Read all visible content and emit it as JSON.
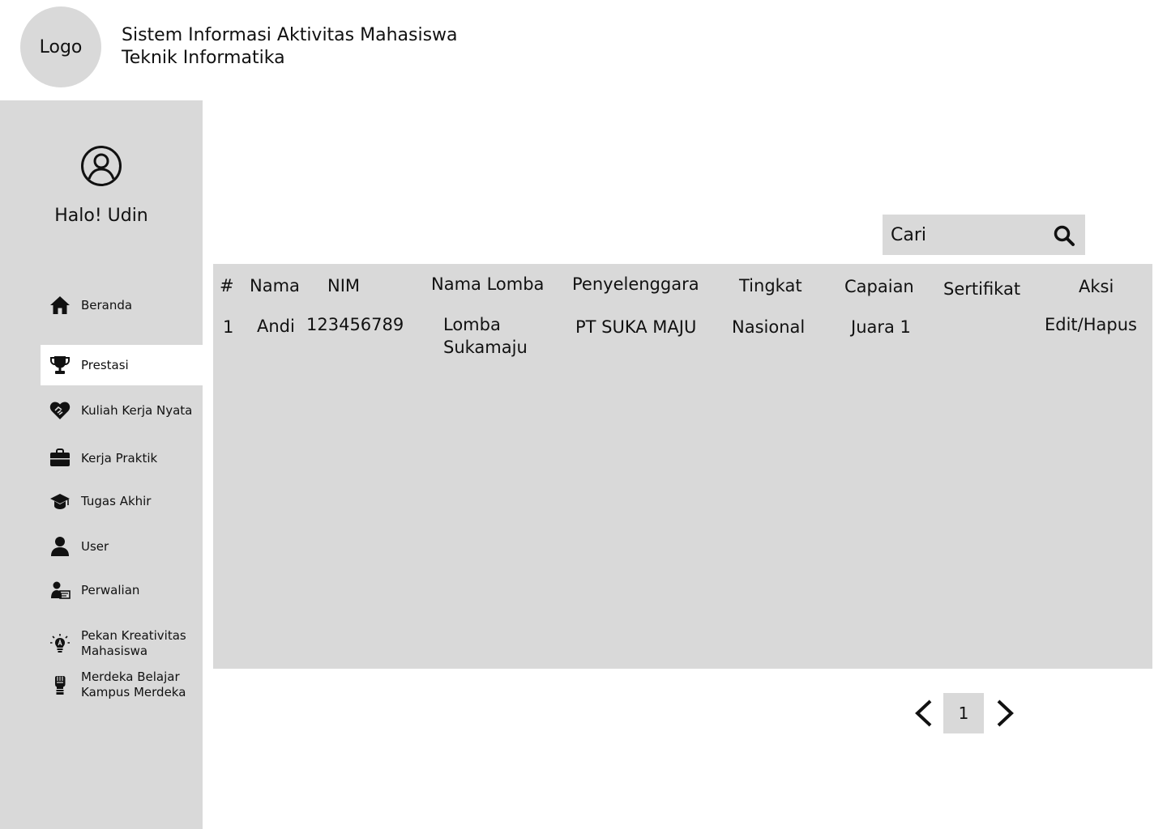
{
  "header": {
    "logo_text": "Logo",
    "title_line1": "Sistem Informasi Aktivitas Mahasiswa",
    "title_line2": "Teknik Informatika"
  },
  "sidebar": {
    "greeting": "Halo! Udin",
    "items": [
      {
        "label": "Beranda",
        "icon": "home-icon"
      },
      {
        "label": "Prestasi",
        "icon": "trophy-icon",
        "active": true
      },
      {
        "label": "Kuliah Kerja Nyata",
        "icon": "handshake-heart-icon"
      },
      {
        "label": "Kerja Praktik",
        "icon": "briefcase-icon"
      },
      {
        "label": "Tugas Akhir",
        "icon": "graduation-cap-icon"
      },
      {
        "label": "User",
        "icon": "user-icon"
      },
      {
        "label": "Perwalian",
        "icon": "teacher-icon"
      },
      {
        "label": "Pekan Kreativitas\nMahasiswa",
        "icon": "lightbulb-icon"
      },
      {
        "label": "Merdeka Belajar\nKampus Merdeka",
        "icon": "raised-fist-icon"
      }
    ]
  },
  "search": {
    "placeholder": "Cari",
    "icon": "search-icon"
  },
  "table": {
    "headers": [
      "#",
      "Nama",
      "NIM",
      "Nama Lomba",
      "Penyelenggara",
      "Tingkat",
      "Capaian",
      "Sertifikat",
      "Aksi"
    ],
    "rows": [
      [
        "1",
        "Andi",
        "123456789",
        "Lomba\nSukamaju",
        "PT SUKA MAJU",
        "Nasional",
        "Juara 1",
        "",
        "Edit/Hapus"
      ]
    ]
  },
  "pagination": {
    "current_page": "1",
    "prev_icon": "chevron-left-icon",
    "next_icon": "chevron-right-icon"
  }
}
